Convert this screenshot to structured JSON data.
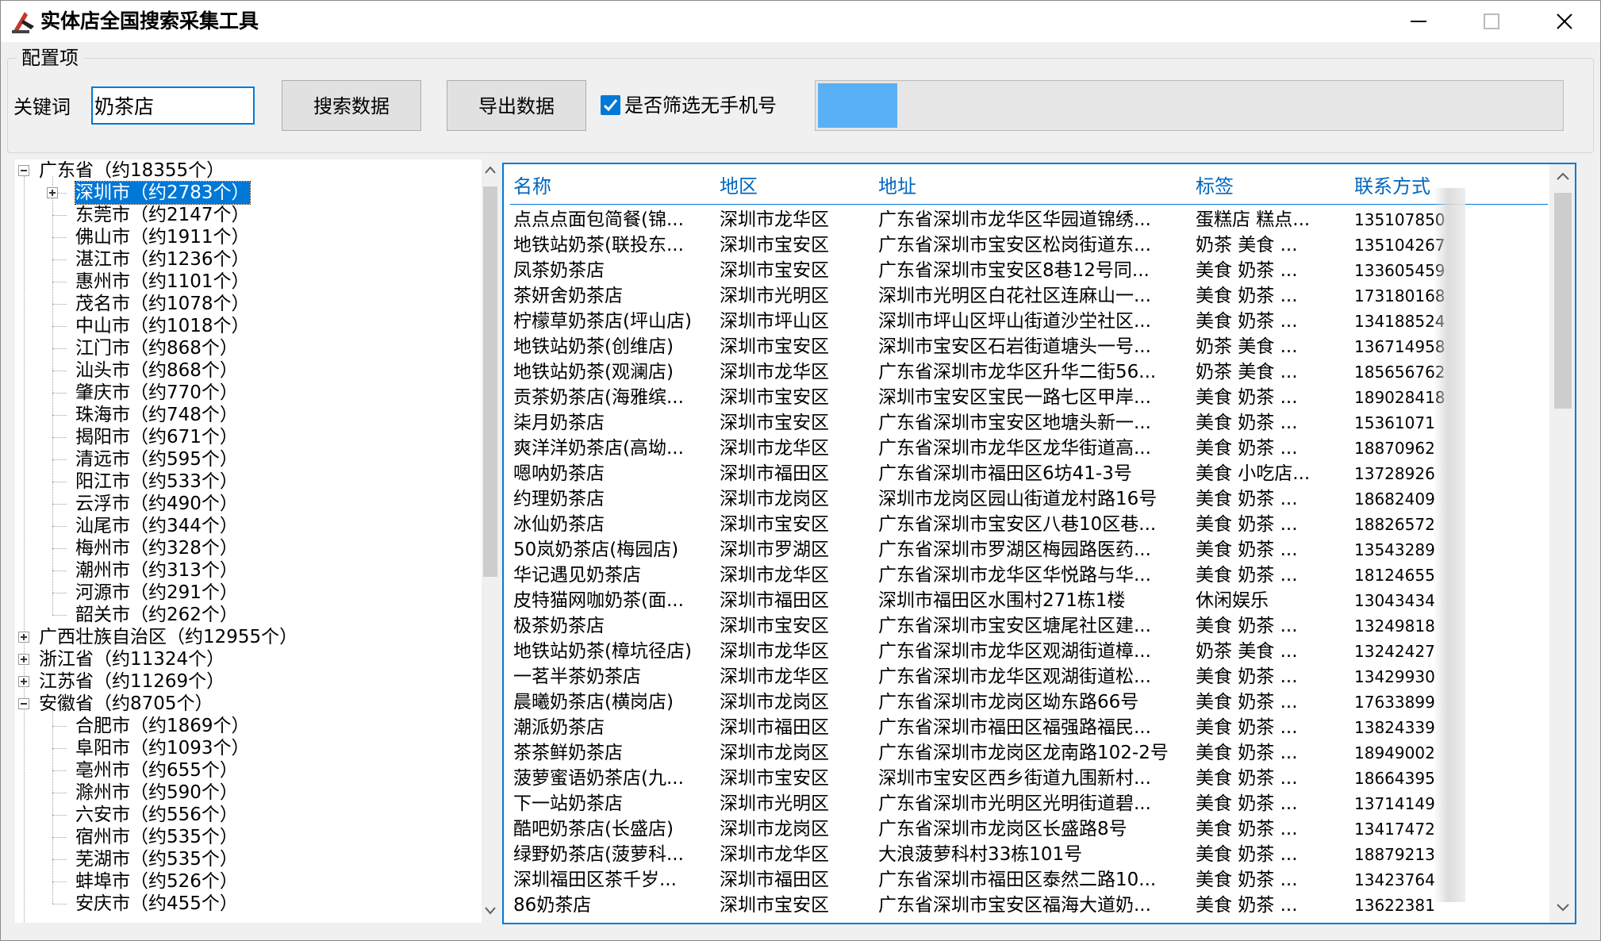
{
  "window": {
    "title": "实体店全国搜索采集工具"
  },
  "config": {
    "group_label": "配置项",
    "keyword_label": "关键词",
    "keyword_value": "奶茶店",
    "search_button": "搜索数据",
    "export_button": "导出数据",
    "filter_checkbox_label": "是否筛选无手机号",
    "filter_checked": true,
    "progress_fraction": 0.107
  },
  "tree": [
    {
      "label": "广东省（约18355个）",
      "level": 0,
      "expander": "minus"
    },
    {
      "label": "深圳市（约2783个）",
      "level": 1,
      "expander": "plus",
      "selected": true
    },
    {
      "label": "东莞市（约2147个）",
      "level": 1
    },
    {
      "label": "佛山市（约1911个）",
      "level": 1
    },
    {
      "label": "湛江市（约1236个）",
      "level": 1
    },
    {
      "label": "惠州市（约1101个）",
      "level": 1
    },
    {
      "label": "茂名市（约1078个）",
      "level": 1
    },
    {
      "label": "中山市（约1018个）",
      "level": 1
    },
    {
      "label": "江门市（约868个）",
      "level": 1
    },
    {
      "label": "汕头市（约868个）",
      "level": 1
    },
    {
      "label": "肇庆市（约770个）",
      "level": 1
    },
    {
      "label": "珠海市（约748个）",
      "level": 1
    },
    {
      "label": "揭阳市（约671个）",
      "level": 1
    },
    {
      "label": "清远市（约595个）",
      "level": 1
    },
    {
      "label": "阳江市（约533个）",
      "level": 1
    },
    {
      "label": "云浮市（约490个）",
      "level": 1
    },
    {
      "label": "汕尾市（约344个）",
      "level": 1
    },
    {
      "label": "梅州市（约328个）",
      "level": 1
    },
    {
      "label": "潮州市（约313个）",
      "level": 1
    },
    {
      "label": "河源市（约291个）",
      "level": 1
    },
    {
      "label": "韶关市（约262个）",
      "level": 1
    },
    {
      "label": "广西壮族自治区（约12955个）",
      "level": 0,
      "expander": "plus"
    },
    {
      "label": "浙江省（约11324个）",
      "level": 0,
      "expander": "plus"
    },
    {
      "label": "江苏省（约11269个）",
      "level": 0,
      "expander": "plus"
    },
    {
      "label": "安徽省（约8705个）",
      "level": 0,
      "expander": "minus"
    },
    {
      "label": "合肥市（约1869个）",
      "level": 1
    },
    {
      "label": "阜阳市（约1093个）",
      "level": 1
    },
    {
      "label": "亳州市（约655个）",
      "level": 1
    },
    {
      "label": "滁州市（约590个）",
      "level": 1
    },
    {
      "label": "六安市（约556个）",
      "level": 1
    },
    {
      "label": "宿州市（约535个）",
      "level": 1
    },
    {
      "label": "芜湖市（约535个）",
      "level": 1
    },
    {
      "label": "蚌埠市（约526个）",
      "level": 1
    },
    {
      "label": "安庆市（约455个）",
      "level": 1
    }
  ],
  "table": {
    "headers": [
      "名称",
      "地区",
      "地址",
      "标签",
      "联系方式"
    ],
    "rows": [
      [
        "点点点面包简餐(锦...",
        "深圳市龙华区",
        "广东省深圳市龙华区华园道锦绣...",
        "蛋糕店 糕点...",
        "135107850"
      ],
      [
        "地铁站奶茶(联投东...",
        "深圳市宝安区",
        "广东省深圳市宝安区松岗街道东...",
        "奶茶 美食 ...",
        "135104267"
      ],
      [
        "凤茶奶茶店",
        "深圳市宝安区",
        "广东省深圳市宝安区8巷12号同...",
        "美食 奶茶 ...",
        "133605459"
      ],
      [
        "茶妍舍奶茶店",
        "深圳市光明区",
        "深圳市光明区白花社区连麻山一...",
        "美食 奶茶 ...",
        "173180168"
      ],
      [
        "柠檬草奶茶店(坪山店)",
        "深圳市坪山区",
        "深圳市坪山区坪山街道沙坣社区...",
        "美食 奶茶 ...",
        "134188524"
      ],
      [
        "地铁站奶茶(创维店)",
        "深圳市宝安区",
        "深圳市宝安区石岩街道塘头一号...",
        "奶茶 美食 ...",
        "136714958"
      ],
      [
        "地铁站奶茶(观澜店)",
        "深圳市龙华区",
        "广东省深圳市龙华区升华二街56...",
        "奶茶 美食 ...",
        "185656762"
      ],
      [
        "贡茶奶茶店(海雅缤...",
        "深圳市宝安区",
        "深圳市宝安区宝民一路七区甲岸...",
        "美食 奶茶 ...",
        "189028418"
      ],
      [
        "柒月奶茶店",
        "深圳市宝安区",
        "广东省深圳市宝安区地塘头新一...",
        "美食 奶茶 ...",
        "15361071"
      ],
      [
        "爽洋洋奶茶店(高坳...",
        "深圳市龙华区",
        "广东省深圳市龙华区龙华街道高...",
        "美食 奶茶 ...",
        "18870962"
      ],
      [
        "嗯呐奶茶店",
        "深圳市福田区",
        "广东省深圳市福田区6坊41-3号",
        "美食 小吃店...",
        "13728926"
      ],
      [
        "约理奶茶店",
        "深圳市龙岗区",
        "深圳市龙岗区园山街道龙村路16号",
        "美食 奶茶 ...",
        "18682409"
      ],
      [
        "冰仙奶茶店",
        "深圳市宝安区",
        "广东省深圳市宝安区八巷10区巷...",
        "美食 奶茶 ...",
        "18826572"
      ],
      [
        "50岚奶茶店(梅园店)",
        "深圳市罗湖区",
        "广东省深圳市罗湖区梅园路医药...",
        "美食 奶茶 ...",
        "13543289"
      ],
      [
        "华记遇见奶茶店",
        "深圳市龙华区",
        "广东省深圳市龙华区华悦路与华...",
        "美食 奶茶 ...",
        "18124655"
      ],
      [
        "皮特猫网咖奶茶(面...",
        "深圳市福田区",
        "深圳市福田区水围村271栋1楼",
        "休闲娱乐",
        "13043434"
      ],
      [
        "极茶奶茶店",
        "深圳市宝安区",
        "广东省深圳市宝安区塘尾社区建...",
        "美食 奶茶 ...",
        "13249818"
      ],
      [
        "地铁站奶茶(樟坑径店)",
        "深圳市龙华区",
        "广东省深圳市龙华区观湖街道樟...",
        "奶茶 美食 ...",
        "13242427"
      ],
      [
        "一茗半茶奶茶店",
        "深圳市龙华区",
        "广东省深圳市龙华区观湖街道松...",
        "美食 奶茶 ...",
        "13429930"
      ],
      [
        "晨曦奶茶店(横岗店)",
        "深圳市龙岗区",
        "广东省深圳市龙岗区坳东路66号",
        "美食 奶茶 ...",
        "17633899"
      ],
      [
        "潮派奶茶店",
        "深圳市福田区",
        "广东省深圳市福田区福强路福民...",
        "美食 奶茶 ...",
        "13824339"
      ],
      [
        "茶茶鲜奶茶店",
        "深圳市龙岗区",
        "广东省深圳市龙岗区龙南路102-2号",
        "美食 奶茶 ...",
        "18949002"
      ],
      [
        "菠萝蜜语奶茶店(九...",
        "深圳市宝安区",
        "深圳市宝安区西乡街道九围新村...",
        "美食 奶茶 ...",
        "18664395"
      ],
      [
        "下一站奶茶店",
        "深圳市光明区",
        "广东省深圳市光明区光明街道碧...",
        "美食 奶茶 ...",
        "13714149"
      ],
      [
        "酷吧奶茶店(长盛店)",
        "深圳市龙岗区",
        "广东省深圳市龙岗区长盛路8号",
        "美食 奶茶 ...",
        "13417472"
      ],
      [
        "绿野奶茶店(菠萝科...",
        "深圳市龙华区",
        "大浪菠萝科村33栋101号",
        "美食 奶茶 ...",
        "18879213"
      ],
      [
        "深圳福田区茶千岁...",
        "深圳市福田区",
        "广东省深圳市福田区泰然二路10...",
        "美食 奶茶 ...",
        "13423764"
      ],
      [
        "86奶茶店",
        "深圳市宝安区",
        "广东省深圳市宝安区福海大道奶...",
        "美食 奶茶 ...",
        "13622381"
      ]
    ]
  }
}
